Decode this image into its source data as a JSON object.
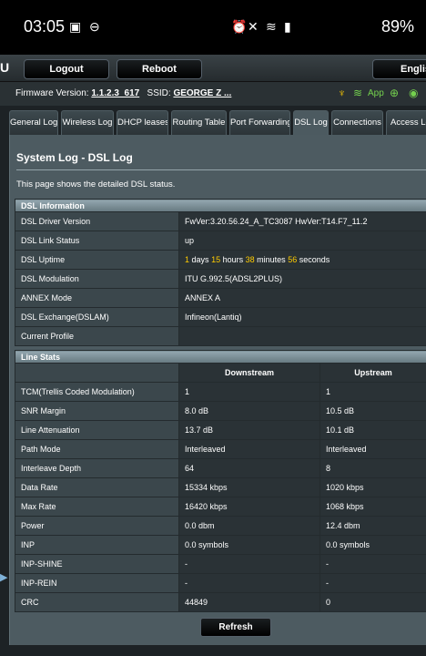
{
  "statusbar": {
    "time": "03:05",
    "battery": "89%"
  },
  "topbar": {
    "logo_fragment": "U",
    "logout_label": "Logout",
    "reboot_label": "Reboot",
    "language_label": "English"
  },
  "infobar": {
    "firmware_label": "Firmware Version:",
    "firmware_value": "1.1.2.3_617",
    "ssid_label": "SSID:",
    "ssid_value": "GEORGE Z ...",
    "app_label": "App"
  },
  "tabs": [
    "General Log",
    "Wireless Log",
    "DHCP leases",
    "Routing Table",
    "Port Forwarding",
    "DSL Log",
    "Connections",
    "Access Log"
  ],
  "page": {
    "title": "System Log - DSL Log",
    "description": "This page shows the detailed DSL status."
  },
  "dsl_info": {
    "header": "DSL Information",
    "rows": [
      {
        "label": "DSL Driver Version",
        "value": "FwVer:3.20.56.24_A_TC3087 HwVer:T14.F7_11.2"
      },
      {
        "label": "DSL Link Status",
        "value": "up"
      },
      {
        "label": "DSL Uptime",
        "value": ""
      },
      {
        "label": "DSL Modulation",
        "value": "ITU G.992.5(ADSL2PLUS)"
      },
      {
        "label": "ANNEX Mode",
        "value": "ANNEX A"
      },
      {
        "label": "DSL Exchange(DSLAM)",
        "value": "Infineon(Lantiq)"
      },
      {
        "label": "Current Profile",
        "value": ""
      }
    ],
    "uptime": {
      "days": "1",
      "days_unit": "days",
      "hours": "15",
      "hours_unit": "hours",
      "minutes": "38",
      "minutes_unit": "minutes",
      "seconds": "56",
      "seconds_unit": "seconds"
    }
  },
  "line_stats": {
    "header": "Line Stats",
    "col_downstream": "Downstream",
    "col_upstream": "Upstream",
    "rows": [
      {
        "label": "TCM(Trellis Coded Modulation)",
        "down": "1",
        "up": "1"
      },
      {
        "label": "SNR Margin",
        "down": "8.0 dB",
        "up": "10.5 dB"
      },
      {
        "label": "Line Attenuation",
        "down": "13.7 dB",
        "up": "10.1 dB"
      },
      {
        "label": "Path Mode",
        "down": "Interleaved",
        "up": "Interleaved"
      },
      {
        "label": "Interleave Depth",
        "down": "64",
        "up": "8"
      },
      {
        "label": "Data Rate",
        "down": "15334 kbps",
        "up": "1020 kbps"
      },
      {
        "label": "Max Rate",
        "down": "16420 kbps",
        "up": "1068 kbps"
      },
      {
        "label": "Power",
        "down": "0.0 dbm",
        "up": "12.4 dbm"
      },
      {
        "label": "INP",
        "down": "0.0 symbols",
        "up": "0.0 symbols"
      },
      {
        "label": "INP-SHINE",
        "down": "-",
        "up": "-"
      },
      {
        "label": "INP-REIN",
        "down": "-",
        "up": "-"
      },
      {
        "label": "CRC",
        "down": "44849",
        "up": "0"
      }
    ]
  },
  "refresh_label": "Refresh",
  "colors": {
    "accent_yellow": "#ffcc00",
    "app_green": "#74d14e",
    "section_header": "#8fa2ab"
  }
}
